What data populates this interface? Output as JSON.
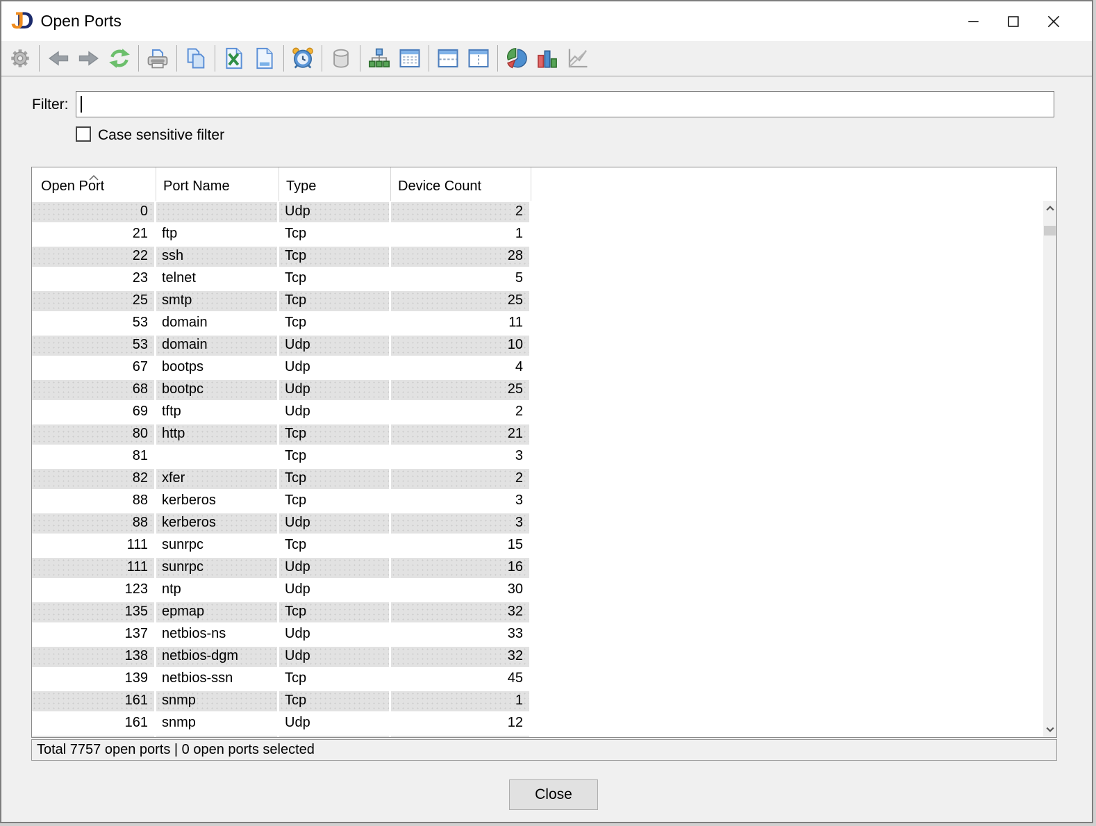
{
  "window": {
    "title": "Open Ports",
    "logo": {
      "j": "J",
      "d": "D"
    },
    "control_icons": [
      "minimize-icon",
      "maximize-icon",
      "close-icon"
    ]
  },
  "toolbar": {
    "icons": [
      {
        "name": "settings-gear-icon",
        "enabled": false
      },
      {
        "name": "back-arrow-icon",
        "enabled": false
      },
      {
        "name": "forward-arrow-icon",
        "enabled": false
      },
      {
        "name": "refresh-icon",
        "enabled": true
      },
      {
        "name": "print-icon",
        "enabled": true
      },
      {
        "name": "copy-icon",
        "enabled": true
      },
      {
        "name": "excel-export-icon",
        "enabled": true
      },
      {
        "name": "report-document-icon",
        "enabled": true
      },
      {
        "name": "schedule-alarm-icon",
        "enabled": true
      },
      {
        "name": "database-icon",
        "enabled": false
      },
      {
        "name": "topology-tree-icon",
        "enabled": true
      },
      {
        "name": "table-view-icon",
        "enabled": true
      },
      {
        "name": "split-horizontal-icon",
        "enabled": true
      },
      {
        "name": "split-vertical-icon",
        "enabled": true
      },
      {
        "name": "pie-chart-icon",
        "enabled": true
      },
      {
        "name": "bar-chart-icon",
        "enabled": true
      },
      {
        "name": "line-chart-icon",
        "enabled": false
      }
    ]
  },
  "filter": {
    "label": "Filter:",
    "value": "",
    "case_checkbox_label": "Case sensitive filter",
    "case_checked": false
  },
  "table": {
    "columns": [
      "Open Port",
      "Port Name",
      "Type",
      "Device Count"
    ],
    "sort": {
      "column": "Open Port",
      "direction": "ascending"
    },
    "rows": [
      [
        0,
        "",
        "Udp",
        2
      ],
      [
        21,
        "ftp",
        "Tcp",
        1
      ],
      [
        22,
        "ssh",
        "Tcp",
        28
      ],
      [
        23,
        "telnet",
        "Tcp",
        5
      ],
      [
        25,
        "smtp",
        "Tcp",
        25
      ],
      [
        53,
        "domain",
        "Tcp",
        11
      ],
      [
        53,
        "domain",
        "Udp",
        10
      ],
      [
        67,
        "bootps",
        "Udp",
        4
      ],
      [
        68,
        "bootpc",
        "Udp",
        25
      ],
      [
        69,
        "tftp",
        "Udp",
        2
      ],
      [
        80,
        "http",
        "Tcp",
        21
      ],
      [
        81,
        "",
        "Tcp",
        3
      ],
      [
        82,
        "xfer",
        "Tcp",
        2
      ],
      [
        88,
        "kerberos",
        "Tcp",
        3
      ],
      [
        88,
        "kerberos",
        "Udp",
        3
      ],
      [
        111,
        "sunrpc",
        "Tcp",
        15
      ],
      [
        111,
        "sunrpc",
        "Udp",
        16
      ],
      [
        123,
        "ntp",
        "Udp",
        30
      ],
      [
        135,
        "epmap",
        "Tcp",
        32
      ],
      [
        137,
        "netbios-ns",
        "Udp",
        33
      ],
      [
        138,
        "netbios-dgm",
        "Udp",
        32
      ],
      [
        139,
        "netbios-ssn",
        "Tcp",
        45
      ],
      [
        161,
        "snmp",
        "Tcp",
        1
      ],
      [
        161,
        "snmp",
        "Udp",
        12
      ]
    ]
  },
  "status_bar": {
    "text": "Total 7757 open ports | 0 open ports selected"
  },
  "footer": {
    "close_label": "Close"
  },
  "colors": {
    "accent_blue": "#5b8fd6",
    "row_stripe": "#e2e2e2",
    "toolbar_bg": "#f0f0f0",
    "logo_orange": "#f08c1e",
    "logo_navy": "#1b2a6b"
  }
}
